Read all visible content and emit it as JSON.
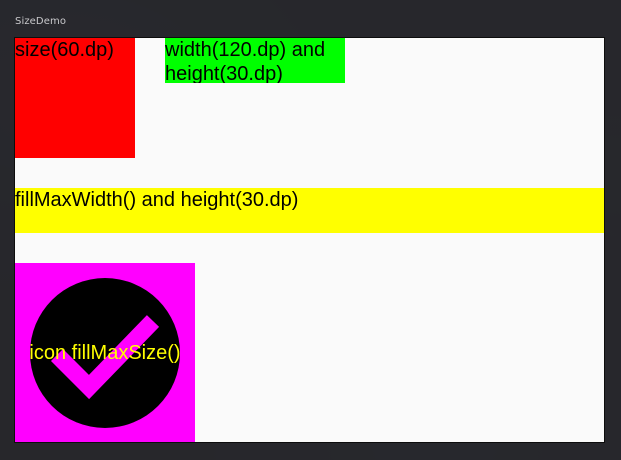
{
  "window": {
    "title": "SizeDemo"
  },
  "boxes": {
    "red": {
      "label": "size(60.dp)",
      "color": "#ff0000"
    },
    "green": {
      "label": "width(120.dp) and height(30.dp)",
      "color": "#00ff00"
    },
    "yellow": {
      "label": "fillMaxWidth() and height(30.dp)",
      "color": "#ffff00"
    },
    "magenta": {
      "label": "icon fillMaxSize()",
      "color": "#ff00ff",
      "icon": "check-circle-icon",
      "icon_color": "#000000",
      "check_color": "#ff00ff",
      "label_color": "#ffff00"
    }
  },
  "colors": {
    "content_background": "#fafafa"
  }
}
